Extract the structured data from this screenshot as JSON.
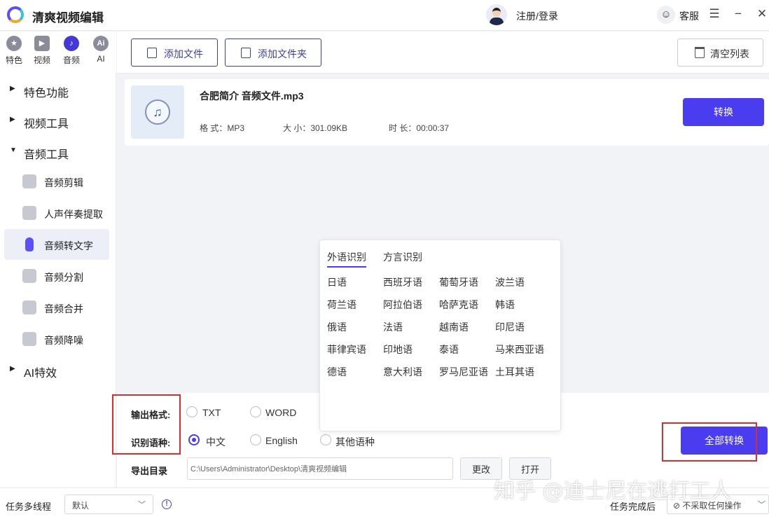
{
  "app": {
    "title": "清爽视频编辑"
  },
  "header": {
    "login": "注册/登录",
    "service": "客服"
  },
  "categories": [
    {
      "label": "特色",
      "glyph": "★"
    },
    {
      "label": "视频",
      "glyph": "▶"
    },
    {
      "label": "音频",
      "glyph": "♪"
    },
    {
      "label": "AI",
      "glyph": "Ai"
    }
  ],
  "sidebar": {
    "groups": [
      "特色功能",
      "视频工具",
      "音频工具",
      "AI特效"
    ],
    "audio_items": [
      "音频剪辑",
      "人声伴奏提取",
      "音频转文字",
      "音频分割",
      "音频合并",
      "音频降噪"
    ]
  },
  "toolbar": {
    "add_file": "添加文件",
    "add_folder": "添加文件夹",
    "clear_list": "清空列表"
  },
  "file": {
    "name": "合肥简介 音频文件.mp3",
    "format": "格 式：MP3",
    "size": "大 小：301.09KB",
    "duration": "时 长：00:00:37",
    "convert": "转换"
  },
  "languages": {
    "tabs": [
      "外语识别",
      "方言识别"
    ],
    "foreign": [
      "日语",
      "西班牙语",
      "葡萄牙语",
      "波兰语",
      "荷兰语",
      "阿拉伯语",
      "哈萨克语",
      "韩语",
      "俄语",
      "法语",
      "越南语",
      "印尼语",
      "菲律宾语",
      "印地语",
      "泰语",
      "马来西亚语",
      "德语",
      "意大利语",
      "罗马尼亚语",
      "土耳其语"
    ]
  },
  "options": {
    "output_format_label": "输出格式:",
    "format_options": [
      "TXT",
      "WORD"
    ],
    "language_label": "识别语种:",
    "language_options": [
      "中文",
      "English",
      "其他语种"
    ],
    "export_label": "导出目录",
    "export_path": "C:\\Users\\Administrator\\Desktop\\清爽视频编辑",
    "change": "更改",
    "open": "打开",
    "convert_all": "全部转换"
  },
  "status": {
    "threads_label": "任务多线程",
    "threads_value": "默认",
    "after_label": "任务完成后",
    "after_value": "不采取任何操作"
  },
  "watermark": "知乎 @迪士尼在逃打工人",
  "colors": {
    "accent": "#4a3df0",
    "highlight": "#e02b2b"
  }
}
